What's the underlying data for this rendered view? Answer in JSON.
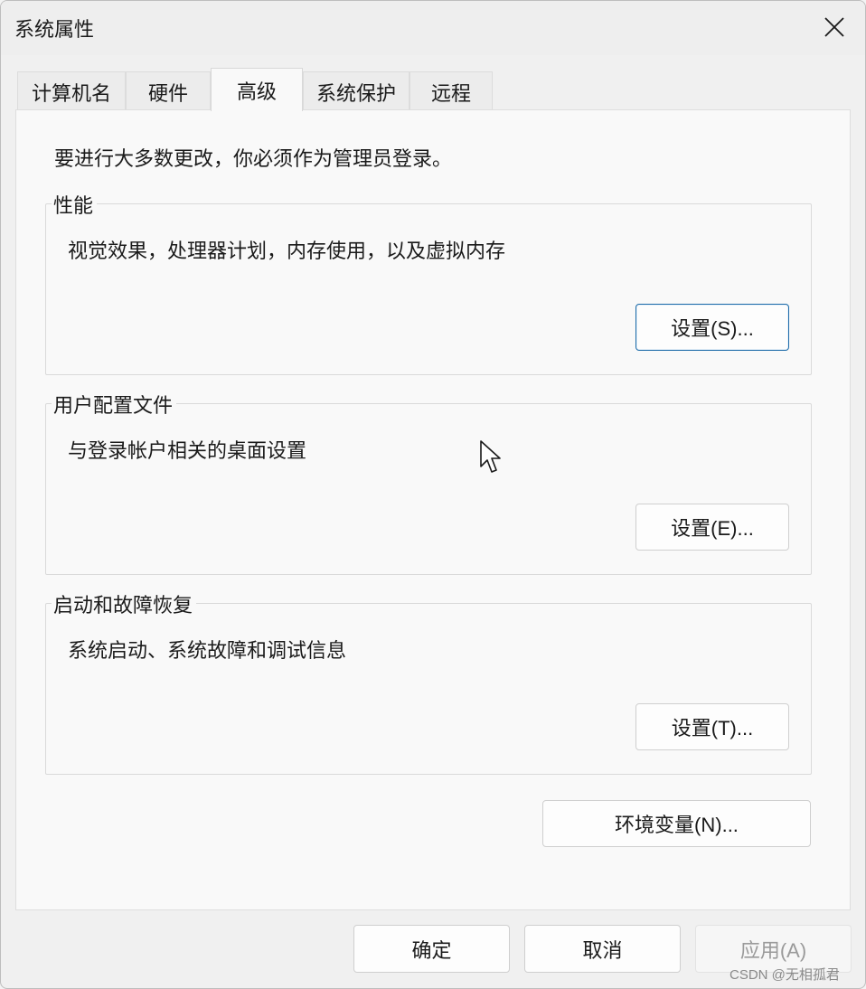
{
  "window": {
    "title": "系统属性"
  },
  "tabs": [
    {
      "label": "计算机名"
    },
    {
      "label": "硬件"
    },
    {
      "label": "高级"
    },
    {
      "label": "系统保护"
    },
    {
      "label": "远程"
    }
  ],
  "notice": "要进行大多数更改，你必须作为管理员登录。",
  "groups": {
    "performance": {
      "label": "性能",
      "desc": "视觉效果，处理器计划，内存使用，以及虚拟内存",
      "button": "设置(S)..."
    },
    "profiles": {
      "label": "用户配置文件",
      "desc": "与登录帐户相关的桌面设置",
      "button": "设置(E)..."
    },
    "startup": {
      "label": "启动和故障恢复",
      "desc": "系统启动、系统故障和调试信息",
      "button": "设置(T)..."
    }
  },
  "env_button": "环境变量(N)...",
  "footer": {
    "ok": "确定",
    "cancel": "取消",
    "apply": "应用(A)"
  },
  "watermark": "CSDN @无相孤君",
  "icons": {
    "close": "close-icon",
    "cursor": "mouse-pointer-icon"
  }
}
